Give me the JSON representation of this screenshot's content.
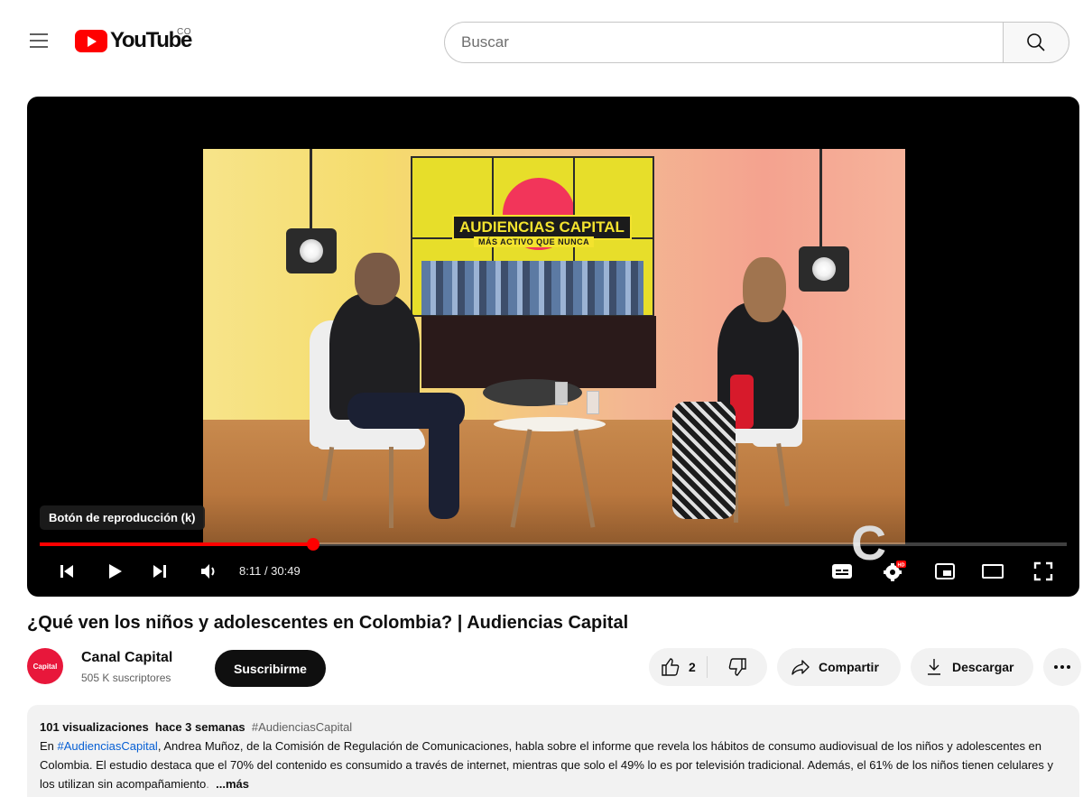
{
  "header": {
    "logo_text": "YouTube",
    "country_code": "CO",
    "search_placeholder": "Buscar"
  },
  "player": {
    "tooltip": "Botón de reproducción (k)",
    "current_time": "8:11",
    "duration": "30:49",
    "time_display": "8:11 / 30:49",
    "progress_fraction": 0.266,
    "scene_banner": "AUDIENCIAS CAPITAL",
    "scene_banner_sub": "MÁS ACTIVO QUE NUNCA",
    "accent_color": "#ff0000",
    "controls": [
      "previous-icon",
      "play-icon",
      "next-icon",
      "volume-icon",
      "subtitles-icon",
      "settings-icon",
      "miniplayer-icon",
      "theater-icon",
      "fullscreen-icon"
    ],
    "settings_badge": "HD"
  },
  "video": {
    "title": "¿Qué ven los niños y adolescentes en Colombia? | Audiencias Capital"
  },
  "channel": {
    "name": "Canal Capital",
    "subscribers": "505 K suscriptores",
    "subscribe_label": "Suscribirme",
    "avatar_text": "Capital"
  },
  "actions": {
    "like_count": "2",
    "share_label": "Compartir",
    "download_label": "Descargar"
  },
  "description": {
    "views": "101 visualizaciones",
    "age": "hace 3 semanas",
    "hashtag": "#AudienciasCapital",
    "text_prefix": "En ",
    "inline_hashtag": "#AudienciasCapital",
    "text_body": ", Andrea Muñoz, de la Comisión de Regulación de Comunicaciones, habla sobre el informe que revela los hábitos de consumo audiovisual de los niños y adolescentes en Colombia. El estudio destaca que el 70% del contenido es consumido a través de internet, mientras que solo el 49% lo es por televisión tradicional. Además, el 61% de los niños tienen celulares y los utilizan sin acompañamiento",
    "fade_char": ".",
    "more_label": "...más"
  }
}
